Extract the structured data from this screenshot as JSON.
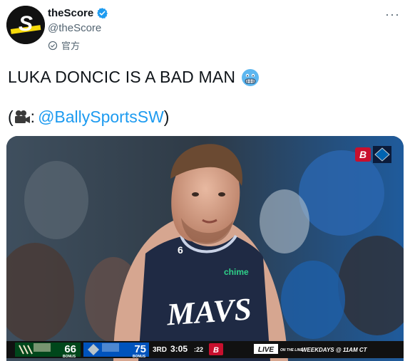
{
  "account": {
    "name": "theScore",
    "handle": "@theScore",
    "affiliation": "官方",
    "logo_letter": "S"
  },
  "tweet": {
    "text": "LUKA DONCIC IS A BAD MAN",
    "credit_open": "(",
    "credit_sep": ":",
    "mention": "@BallySportsSW",
    "credit_close": ")"
  },
  "video": {
    "jersey_number": "6",
    "jersey_sponsor": "chime",
    "jersey_text": "MAVS",
    "network_letter": "B",
    "scoreboard": {
      "away_score": "66",
      "away_label": "BONUS",
      "home_score": "75",
      "home_label": "BONUS",
      "quarter": "3RD",
      "clock": "3:05",
      "shot_clock": ":22",
      "promo_live": "LIVE",
      "promo_on": "ON THE LINE",
      "promo_time": "WEEKDAYS @ 11AM CT"
    }
  },
  "colors": {
    "verified": "#1d9bf0",
    "mention": "#1d9bf0",
    "jersey": "#1f2a44",
    "away_team": "#00471b",
    "home_team": "#0053bc",
    "network": "#c8102e"
  }
}
